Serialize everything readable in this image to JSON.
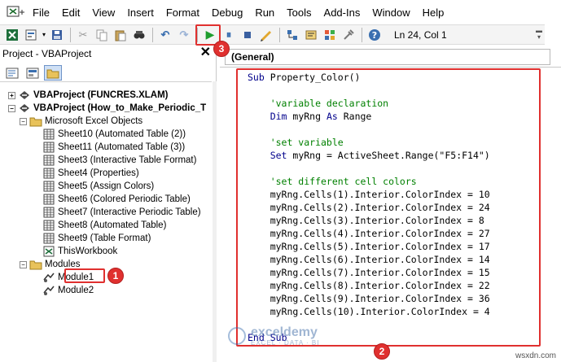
{
  "menu": [
    "File",
    "Edit",
    "View",
    "Insert",
    "Format",
    "Debug",
    "Run",
    "Tools",
    "Add-Ins",
    "Window",
    "Help"
  ],
  "toolbar": {
    "position": "Ln 24, Col 1",
    "icons": [
      "excel-icon",
      "insert-userform-icon",
      "save-icon",
      "cut-icon",
      "copy-icon",
      "paste-icon",
      "find-icon",
      "undo-icon",
      "redo-icon",
      "run-icon",
      "break-icon",
      "reset-icon",
      "design-mode-icon",
      "project-explorer-icon",
      "properties-icon",
      "object-browser-icon",
      "toolbox-icon",
      "help-icon"
    ]
  },
  "project_panel": {
    "title": "Project - VBAProject",
    "close": "✕",
    "tree": [
      {
        "label": "VBAProject (FUNCRES.XLAM)",
        "level": 0,
        "bold": true,
        "expander": "+",
        "icon": "vba-project-icon"
      },
      {
        "label": "VBAProject (How_to_Make_Periodic_T",
        "level": 0,
        "bold": true,
        "expander": "−",
        "icon": "vba-project-icon"
      },
      {
        "label": "Microsoft Excel Objects",
        "level": 1,
        "bold": false,
        "expander": "−",
        "icon": "folder-icon"
      },
      {
        "label": "Sheet10 (Automated Table (2))",
        "level": 2,
        "bold": false,
        "expander": "",
        "icon": "sheet-icon"
      },
      {
        "label": "Sheet11 (Automated Table (3))",
        "level": 2,
        "bold": false,
        "expander": "",
        "icon": "sheet-icon"
      },
      {
        "label": "Sheet3 (Interactive Table Format)",
        "level": 2,
        "bold": false,
        "expander": "",
        "icon": "sheet-icon"
      },
      {
        "label": "Sheet4 (Properties)",
        "level": 2,
        "bold": false,
        "expander": "",
        "icon": "sheet-icon"
      },
      {
        "label": "Sheet5 (Assign Colors)",
        "level": 2,
        "bold": false,
        "expander": "",
        "icon": "sheet-icon"
      },
      {
        "label": "Sheet6 (Colored Periodic Table)",
        "level": 2,
        "bold": false,
        "expander": "",
        "icon": "sheet-icon"
      },
      {
        "label": "Sheet7 (Interactive Periodic Table)",
        "level": 2,
        "bold": false,
        "expander": "",
        "icon": "sheet-icon"
      },
      {
        "label": "Sheet8 (Automated Table)",
        "level": 2,
        "bold": false,
        "expander": "",
        "icon": "sheet-icon"
      },
      {
        "label": "Sheet9 (Table Format)",
        "level": 2,
        "bold": false,
        "expander": "",
        "icon": "sheet-icon"
      },
      {
        "label": "ThisWorkbook",
        "level": 2,
        "bold": false,
        "expander": "",
        "icon": "workbook-icon"
      },
      {
        "label": "Modules",
        "level": 1,
        "bold": false,
        "expander": "−",
        "icon": "folder-icon"
      },
      {
        "label": "Module1",
        "level": 2,
        "bold": false,
        "expander": "",
        "icon": "module-icon"
      },
      {
        "label": "Module2",
        "level": 2,
        "bold": false,
        "expander": "",
        "icon": "module-icon"
      }
    ]
  },
  "code_window": {
    "object_combo": "(General)",
    "lines": [
      {
        "text": "Sub Property_Color()",
        "kind": "code"
      },
      {
        "text": "",
        "kind": "code"
      },
      {
        "text": "    'variable declaration",
        "kind": "comment"
      },
      {
        "text": "    Dim myRng As Range",
        "kind": "code"
      },
      {
        "text": "",
        "kind": "code"
      },
      {
        "text": "    'set variable",
        "kind": "comment"
      },
      {
        "text": "    Set myRng = ActiveSheet.Range(\"F5:F14\")",
        "kind": "code"
      },
      {
        "text": "",
        "kind": "code"
      },
      {
        "text": "    'set different cell colors",
        "kind": "comment"
      },
      {
        "text": "    myRng.Cells(1).Interior.ColorIndex = 10",
        "kind": "code"
      },
      {
        "text": "    myRng.Cells(2).Interior.ColorIndex = 24",
        "kind": "code"
      },
      {
        "text": "    myRng.Cells(3).Interior.ColorIndex = 8",
        "kind": "code"
      },
      {
        "text": "    myRng.Cells(4).Interior.ColorIndex = 27",
        "kind": "code"
      },
      {
        "text": "    myRng.Cells(5).Interior.ColorIndex = 17",
        "kind": "code"
      },
      {
        "text": "    myRng.Cells(6).Interior.ColorIndex = 14",
        "kind": "code"
      },
      {
        "text": "    myRng.Cells(7).Interior.ColorIndex = 15",
        "kind": "code"
      },
      {
        "text": "    myRng.Cells(8).Interior.ColorIndex = 22",
        "kind": "code"
      },
      {
        "text": "    myRng.Cells(9).Interior.ColorIndex = 36",
        "kind": "code"
      },
      {
        "text": "    myRng.Cells(10).Interior.ColorIndex = 4",
        "kind": "code"
      },
      {
        "text": "",
        "kind": "code"
      },
      {
        "text": "End Sub",
        "kind": "code"
      }
    ]
  },
  "annotations": {
    "badge_1": "1",
    "badge_2": "2",
    "badge_3": "3"
  },
  "watermark": {
    "name": "exceldemy",
    "tagline": "EXCEL · DATA · BI"
  },
  "footer": "wsxdn.com",
  "colors": {
    "highlight": "#e0302f",
    "keyword": "#00008b",
    "comment": "#008000",
    "run_green": "#1f9d2e"
  }
}
